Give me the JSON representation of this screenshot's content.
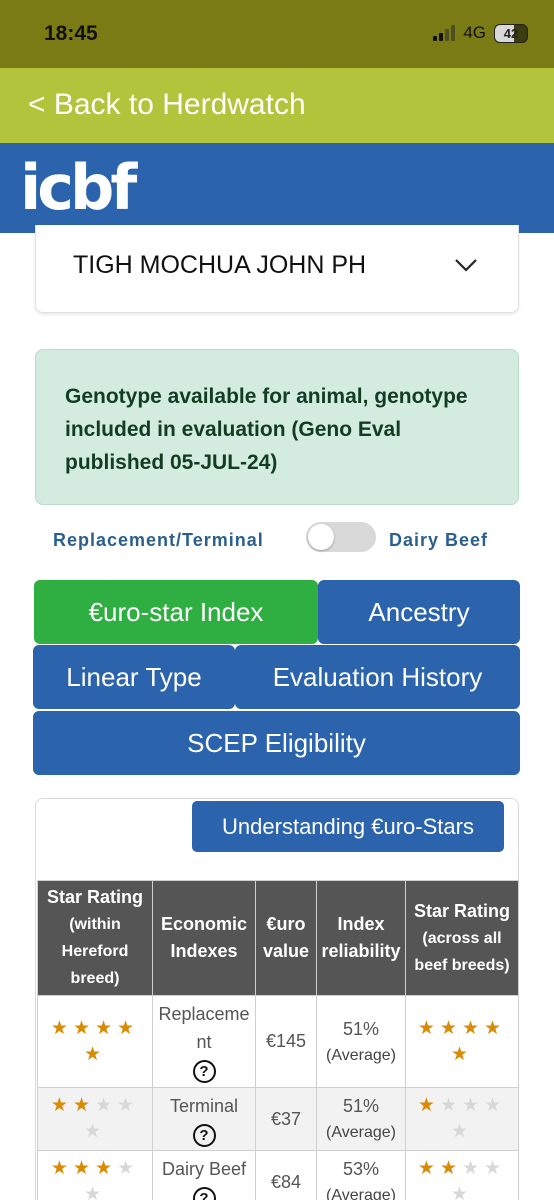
{
  "status": {
    "time": "18:45",
    "network": "4G",
    "battery": "42"
  },
  "back": {
    "label": "< Back to Herdwatch"
  },
  "brand": {
    "logo": "icbf"
  },
  "animal": {
    "name": "TIGH MOCHUA JOHN PH"
  },
  "alert": {
    "text": "Genotype available for animal, genotype included in evaluation (Geno Eval published 05-JUL-24)"
  },
  "toggle": {
    "left_label": "Replacement/Terminal",
    "right_label": "Dairy Beef",
    "on": false
  },
  "tabs": [
    {
      "label": "€uro-star Index",
      "active": true
    },
    {
      "label": "Ancestry",
      "active": false
    },
    {
      "label": "Linear Type",
      "active": false
    },
    {
      "label": "Evaluation History",
      "active": false
    },
    {
      "label": "SCEP Eligibility",
      "active": false
    }
  ],
  "understanding_button": {
    "label": "Understanding €uro-Stars"
  },
  "table": {
    "headers": {
      "within_line1": "Star Rating",
      "within_line2": "(within",
      "within_line3": "Hereford",
      "within_line4": "breed)",
      "econ_line1": "Economic",
      "econ_line2": "Indexes",
      "value_line1": "€uro",
      "value_line2": "value",
      "rel_line1": "Index",
      "rel_line2": "reliability",
      "across_line1": "Star Rating",
      "across_line2": "(across all",
      "across_line3": "beef breeds)"
    },
    "help_icon_glyph": "?",
    "rows": [
      {
        "index_line1": "Replaceme",
        "index_line2": "nt",
        "value": "€145",
        "reliability": "51%",
        "reliability_label": "(Average)",
        "stars_within": 5,
        "stars_across": 5
      },
      {
        "index_line1": "Terminal",
        "index_line2": "",
        "value": "€37",
        "reliability": "51%",
        "reliability_label": "(Average)",
        "stars_within": 2,
        "stars_across": 1
      },
      {
        "index_line1": "Dairy Beef",
        "index_line2": "",
        "value": "€84",
        "reliability": "53%",
        "reliability_label": "(Average)",
        "stars_within": 3,
        "stars_across": 2
      }
    ],
    "max_stars": 5
  },
  "colors": {
    "status_bar": "#7b7b15",
    "back_bar": "#b2c43b",
    "brand_blue": "#2b63ad",
    "active_tab_green": "#2fae42",
    "alert_bg": "#d4ece0",
    "star_on": "#d98b06",
    "star_off": "#d8d8d8",
    "header_gray": "#555555"
  },
  "icons": {
    "chevron": "chevron-down-icon",
    "help": "question-circle-icon",
    "star": "star-icon"
  }
}
